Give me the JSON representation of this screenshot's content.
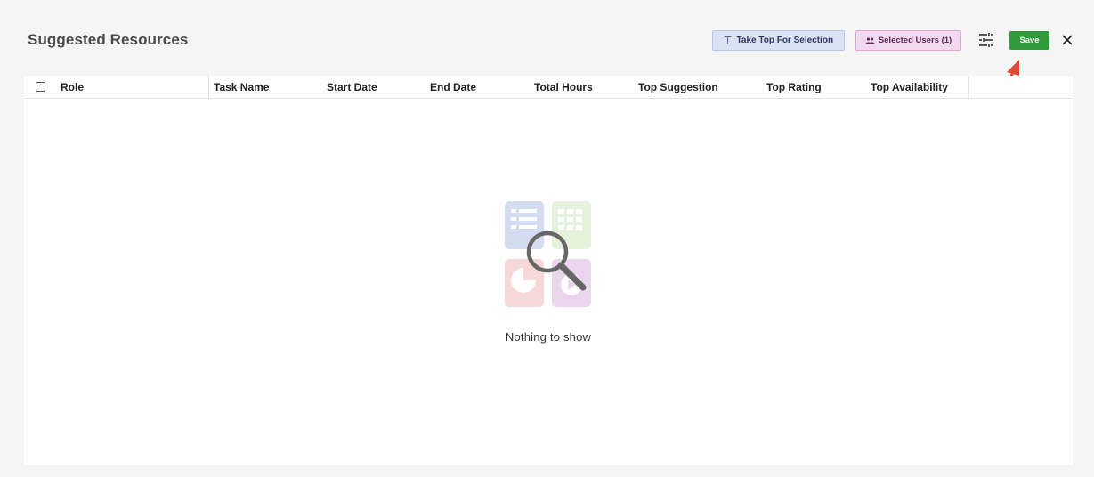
{
  "header": {
    "title": "Suggested Resources",
    "take_top_label": "Take Top For Selection",
    "selected_users_label": "Selected Users (1)",
    "save_label": "Save"
  },
  "table": {
    "columns": [
      "Role",
      "Task Name",
      "Start Date",
      "End Date",
      "Total Hours",
      "Top Suggestion",
      "Top Rating",
      "Top Availability"
    ],
    "rows": []
  },
  "empty_state": {
    "message": "Nothing to show"
  },
  "colors": {
    "save": "#2e9a3a",
    "take_top_bg": "#dbe2f3",
    "selected_users_bg": "#f3d9f0",
    "annotation_arrow": "#e04a33"
  },
  "icons": [
    "align-top-icon",
    "people-icon",
    "tune-icon",
    "close-icon",
    "checkbox-icon",
    "empty-search-icon",
    "annotation-arrow"
  ]
}
